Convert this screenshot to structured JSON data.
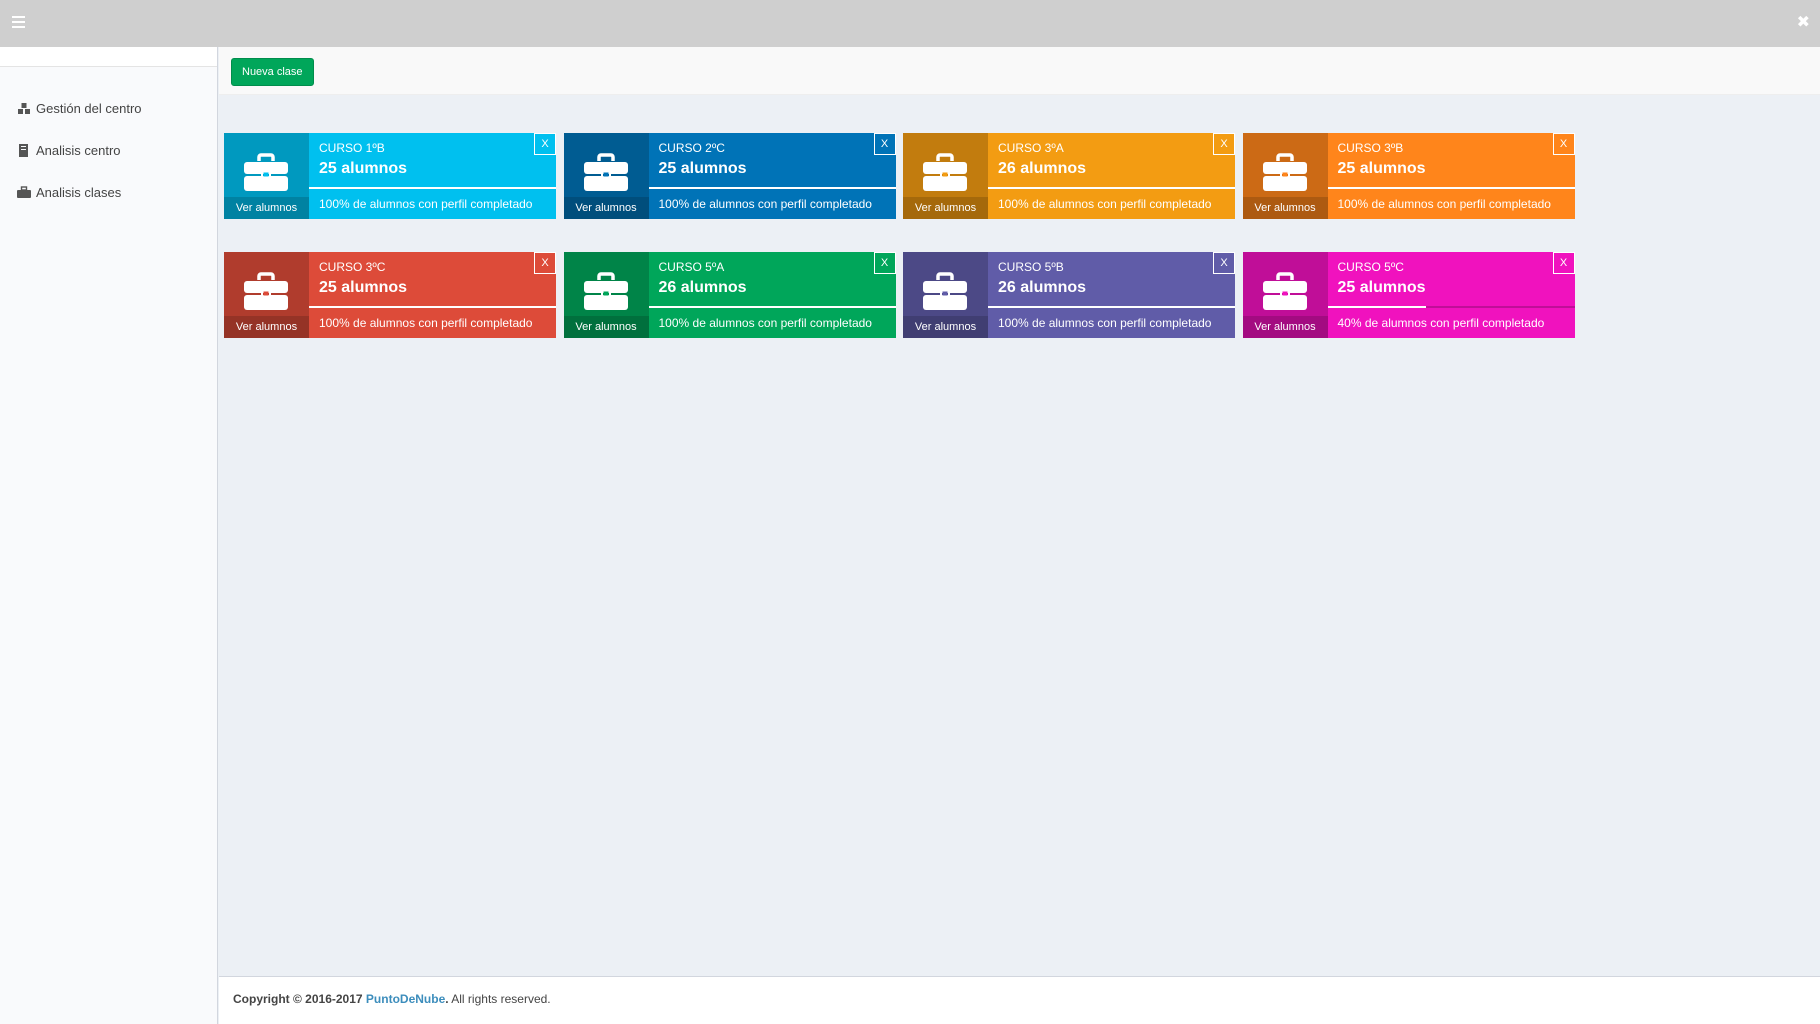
{
  "topbar": {
    "menu_icon": "hamburger-icon",
    "close_icon": "close-icon",
    "close_glyph": "✖"
  },
  "sidebar": {
    "items": [
      {
        "label": "Gestión del centro",
        "icon": "cubes-icon"
      },
      {
        "label": "Analisis centro",
        "icon": "book-icon"
      },
      {
        "label": "Analisis clases",
        "icon": "briefcase-icon"
      }
    ]
  },
  "header": {
    "new_class_label": "Nueva clase"
  },
  "cards": [
    {
      "title": "CURSO 1ºB",
      "students": "25 alumnos",
      "description": "100% de alumnos con perfil completado",
      "progress": 1.0,
      "link": "Ver alumnos",
      "remove": "X",
      "color": "#00c0ef"
    },
    {
      "title": "CURSO 2ºC",
      "students": "25 alumnos",
      "description": "100% de alumnos con perfil completado",
      "progress": 1.0,
      "link": "Ver alumnos",
      "remove": "X",
      "color": "#0073b7"
    },
    {
      "title": "CURSO 3ºA",
      "students": "26 alumnos",
      "description": "100% de alumnos con perfil completado",
      "progress": 1.0,
      "link": "Ver alumnos",
      "remove": "X",
      "color": "#f39c12"
    },
    {
      "title": "CURSO 3ºB",
      "students": "25 alumnos",
      "description": "100% de alumnos con perfil completado",
      "progress": 1.0,
      "link": "Ver alumnos",
      "remove": "X",
      "color": "#ff851b"
    },
    {
      "title": "CURSO 3ºC",
      "students": "25 alumnos",
      "description": "100% de alumnos con perfil completado",
      "progress": 1.0,
      "link": "Ver alumnos",
      "remove": "X",
      "color": "#dd4b39"
    },
    {
      "title": "CURSO 5ºA",
      "students": "26 alumnos",
      "description": "100% de alumnos con perfil completado",
      "progress": 1.0,
      "link": "Ver alumnos",
      "remove": "X",
      "color": "#00a65a"
    },
    {
      "title": "CURSO 5ºB",
      "students": "26 alumnos",
      "description": "100% de alumnos con perfil completado",
      "progress": 1.0,
      "link": "Ver alumnos",
      "remove": "X",
      "color": "#605ca8"
    },
    {
      "title": "CURSO 5ºC",
      "students": "25 alumnos",
      "description": "40% de alumnos con perfil completado",
      "progress": 0.4,
      "link": "Ver alumnos",
      "remove": "X",
      "color": "#f012be"
    }
  ],
  "footer": {
    "copyright": "Copyright © 2016-2017",
    "brand": "PuntoDeNube",
    "period": ".",
    "rights": "All rights reserved."
  }
}
